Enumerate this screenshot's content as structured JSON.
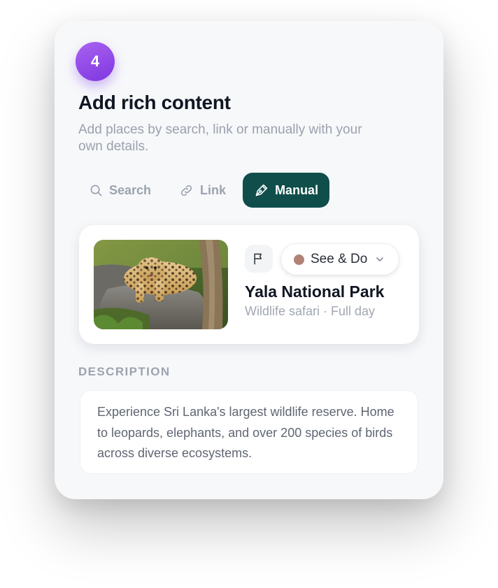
{
  "step": {
    "number": "4"
  },
  "header": {
    "title": "Add rich content",
    "subtitle": "Add places by search, link or manually with your own details."
  },
  "tabs": [
    {
      "label": "Search",
      "icon": "search-icon",
      "active": false
    },
    {
      "label": "Link",
      "icon": "link-icon",
      "active": false
    },
    {
      "label": "Manual",
      "icon": "pen-icon",
      "active": true
    }
  ],
  "place": {
    "photo": "leopard-photo",
    "category": {
      "label": "See & Do",
      "color": "#b08276"
    },
    "name": "Yala National Park",
    "meta": "Wildlife safari · Full day"
  },
  "description": {
    "label": "DESCRIPTION",
    "text": "Experience Sri Lanka's largest wildlife reserve. Home to leopards, elephants, and over 200 species of birds across diverse ecosystems."
  },
  "colors": {
    "accent_teal": "#0f4e4a",
    "badge_purple": "#8b45e8",
    "card_bg": "#f7f8fa"
  }
}
